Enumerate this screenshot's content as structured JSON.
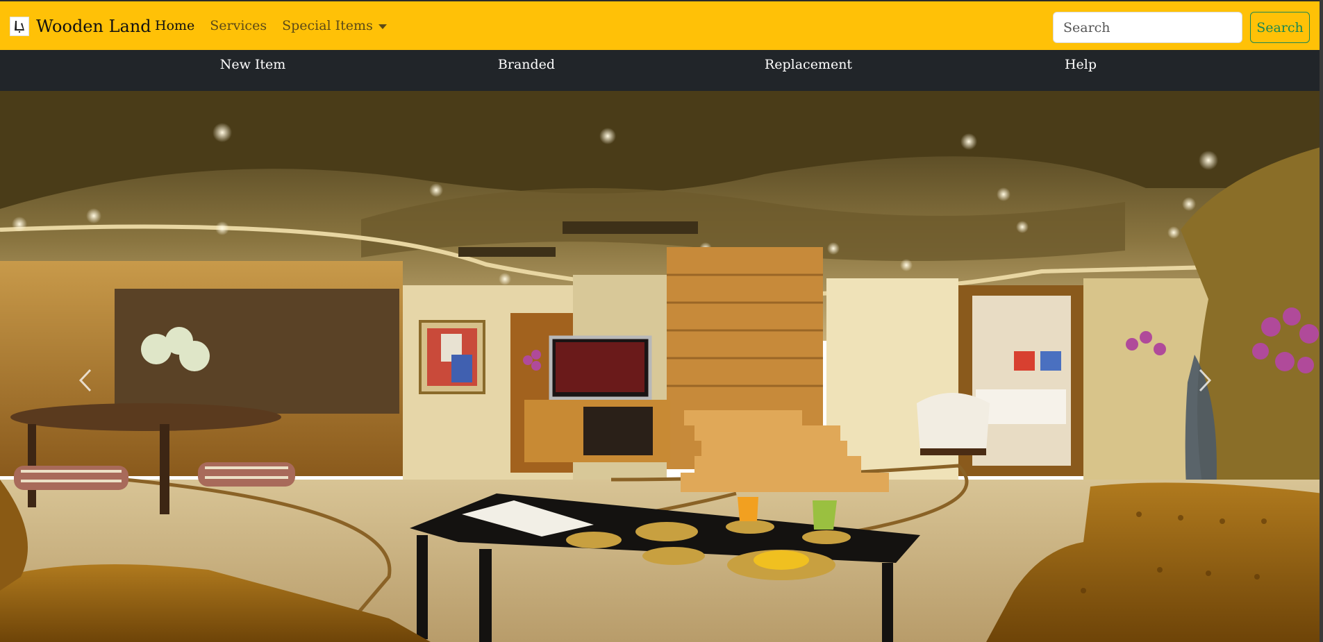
{
  "navbar": {
    "brand": "Wooden Land",
    "links": [
      {
        "label": "Home"
      },
      {
        "label": "Services"
      },
      {
        "label": "Special Items"
      }
    ],
    "search_placeholder": "Search",
    "search_button": "Search"
  },
  "subnav": {
    "items": [
      {
        "label": "New Item"
      },
      {
        "label": "Branded"
      },
      {
        "label": "Replacement"
      },
      {
        "label": "Help"
      }
    ]
  },
  "hero": {
    "image_icon": "living-room-photo",
    "prev_icon": "chevron-left-icon",
    "next_icon": "chevron-right-icon"
  },
  "colors": {
    "navbar_bg": "#ffc107",
    "subnav_bg": "#212529",
    "search_button": "#198754"
  }
}
